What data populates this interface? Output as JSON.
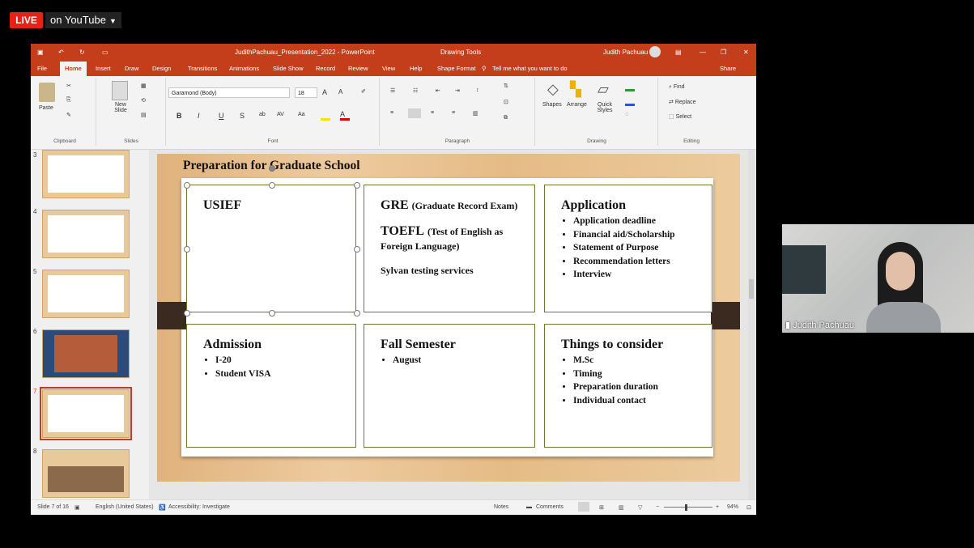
{
  "live_badge": "LIVE",
  "stream_target": "on YouTube",
  "window": {
    "title": "JudithPachuau_Presentation_2022 - PowerPoint",
    "context_tool": "Drawing Tools",
    "user": "Judith Pachuau"
  },
  "tabs": [
    "File",
    "Home",
    "Insert",
    "Draw",
    "Design",
    "Transitions",
    "Animations",
    "Slide Show",
    "Record",
    "Review",
    "View",
    "Help",
    "Shape Format"
  ],
  "tell_me": "Tell me what you want to do",
  "share": "Share",
  "ribbon": {
    "clipboard": {
      "paste": "Paste",
      "label": "Clipboard"
    },
    "slides": {
      "new_slide": "New Slide",
      "label": "Slides"
    },
    "font": {
      "name": "Garamond (Body)",
      "size": "18",
      "label": "Font"
    },
    "paragraph": {
      "label": "Paragraph"
    },
    "drawing": {
      "shapes": "Shapes",
      "arrange": "Arrange",
      "quick_styles": "Quick Styles",
      "label": "Drawing"
    },
    "editing": {
      "find": "Find",
      "replace": "Replace",
      "select": "Select",
      "label": "Editing"
    }
  },
  "thumb_numbers": [
    "3",
    "4",
    "5",
    "6",
    "7",
    "8"
  ],
  "slide": {
    "title": "Preparation for Graduate School",
    "usief": "USIEF",
    "gre_title": "GRE",
    "gre_sub": "(Graduate Record Exam)",
    "toefl_title": "TOEFL",
    "toefl_sub": "(Test of English as Foreign Language)",
    "sylvan": "Sylvan testing services",
    "application_title": "Application",
    "application_items": [
      "Application deadline",
      "Financial aid/Scholarship",
      "Statement of Purpose",
      "Recommendation letters",
      "Interview"
    ],
    "admission_title": "Admission",
    "admission_items": [
      "I-20",
      "Student VISA"
    ],
    "fall_title": "Fall Semester",
    "fall_items": [
      "August"
    ],
    "things_title": "Things to consider",
    "things_items": [
      "M.Sc",
      "Timing",
      "Preparation duration",
      "Individual contact"
    ]
  },
  "status": {
    "slide_count": "Slide 7 of 16",
    "language": "English (United States)",
    "accessibility": "Accessibility: Investigate",
    "notes": "Notes",
    "comments": "Comments",
    "zoom": "94%"
  },
  "webcam_name": "Judith Pachuau",
  "colors": {
    "ppt_accent": "#c43e1c",
    "live_red": "#e62117",
    "cell_border": "#6b7a2a"
  }
}
